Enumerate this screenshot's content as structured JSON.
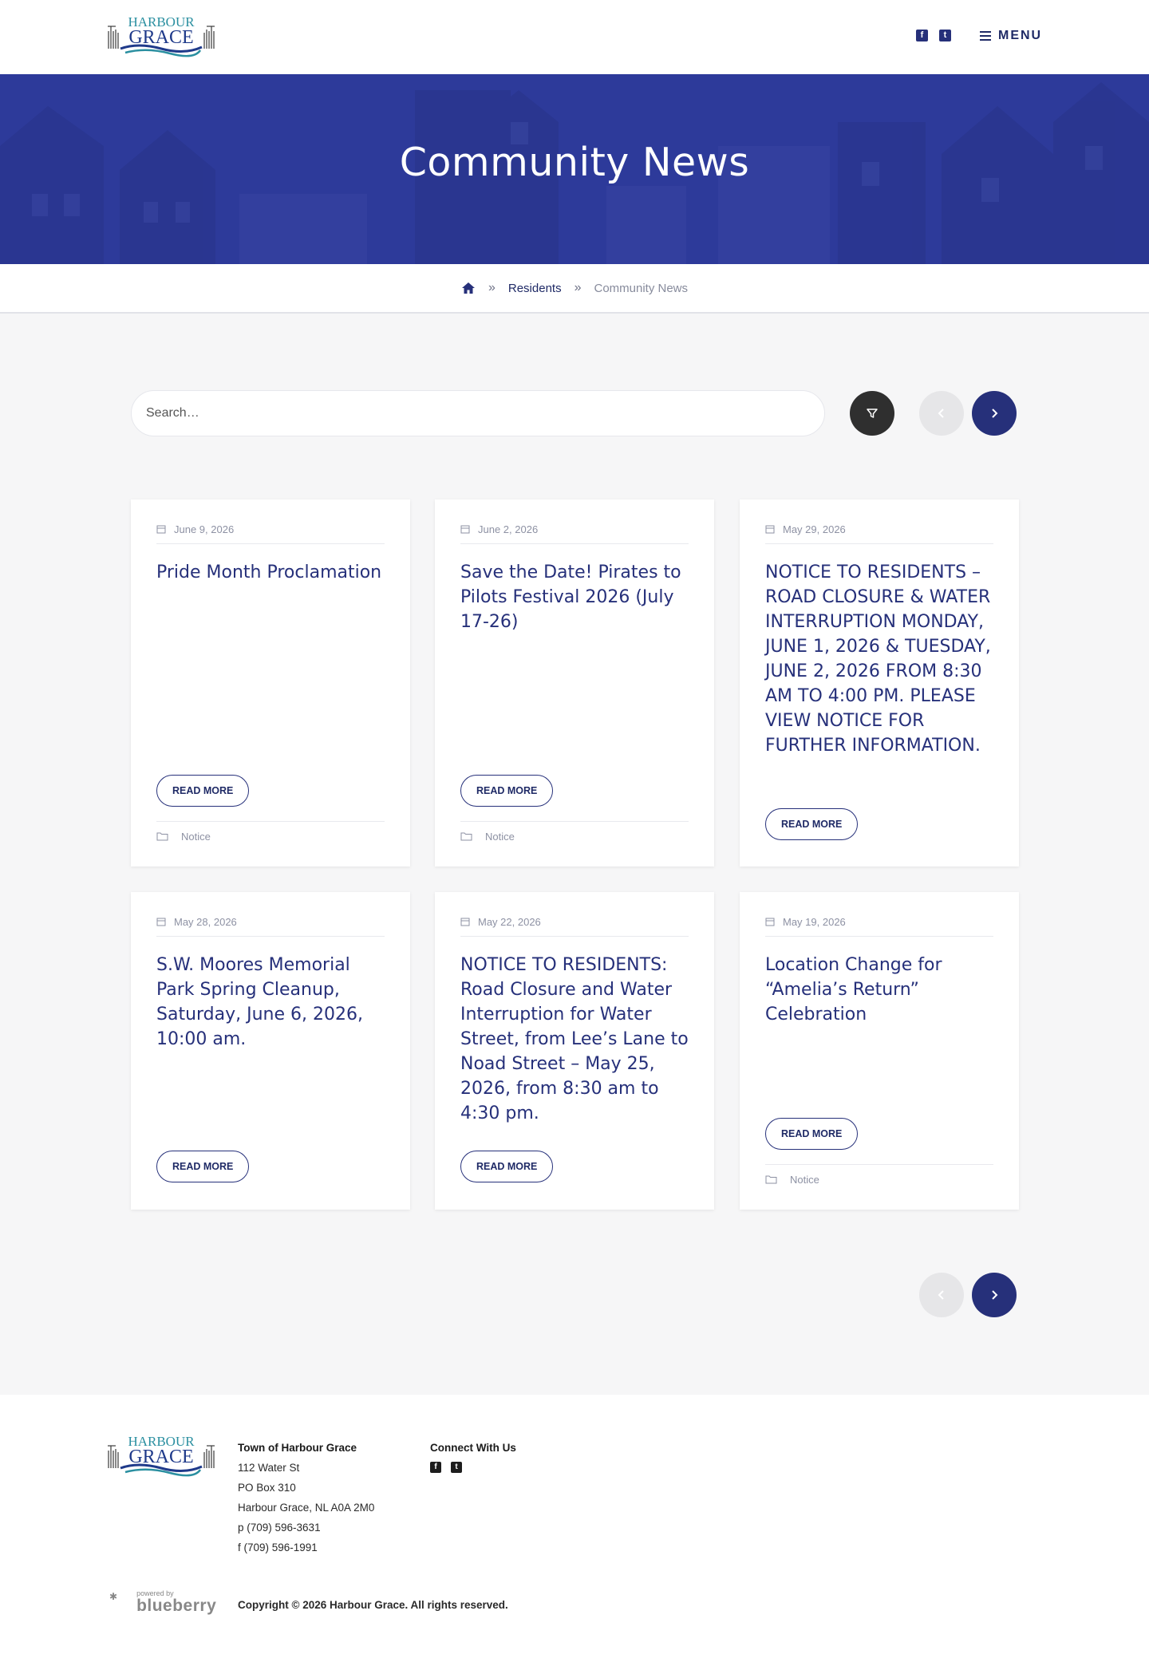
{
  "header": {
    "logo_text": [
      "HARBOUR",
      "GRACE"
    ],
    "social": [
      "facebook-icon",
      "twitter-icon"
    ],
    "menu_label": "MENU"
  },
  "hero": {
    "title": "Community News"
  },
  "breadcrumb": {
    "home_icon": "home-icon",
    "items": [
      "Residents",
      "Community News"
    ]
  },
  "search": {
    "placeholder": "Search…"
  },
  "cards": [
    {
      "date": "June 9, 2026",
      "title": "Pride Month Proclamation",
      "button": "READ MORE",
      "category": "Notice"
    },
    {
      "date": "June 2, 2026",
      "title": "Save the Date! Pirates to Pilots Festival 2026 (July 17-26)",
      "button": "READ MORE",
      "category": "Notice"
    },
    {
      "date": "May 29, 2026",
      "title": "NOTICE TO RESIDENTS – ROAD CLOSURE & WATER INTERRUPTION MONDAY, JUNE 1, 2026 & TUESDAY, JUNE 2, 2026 FROM 8:30 AM TO 4:00 PM. PLEASE VIEW NOTICE FOR FURTHER INFORMATION.",
      "button": "READ MORE",
      "category": ""
    },
    {
      "date": "May 28, 2026",
      "title": "S.W. Moores Memorial Park Spring Cleanup, Saturday, June 6, 2026, 10:00 am.",
      "button": "READ MORE",
      "category": ""
    },
    {
      "date": "May 22, 2026",
      "title": "NOTICE TO RESIDENTS: Road Closure and Water Interruption for Water Street, from Lee’s Lane to Noad Street – May 25, 2026, from 8:30 am to 4:30 pm.",
      "button": "READ MORE",
      "category": ""
    },
    {
      "date": "May 19, 2026",
      "title": "Location Change for “Amelia’s Return” Celebration",
      "button": "READ MORE",
      "category": "Notice"
    }
  ],
  "footer": {
    "org_name": "Town of Harbour Grace",
    "address": [
      "112 Water St",
      "PO Box 310",
      "Harbour Grace, NL A0A 2M0"
    ],
    "phone": "p (709) 596-3631",
    "fax": "f (709) 596-1991",
    "connect_heading": "Connect With Us",
    "powered_small": "powered by",
    "powered_brand": "blueberry",
    "copyright": "Copyright © 2026 Harbour Grace. All rights reserved."
  },
  "colors": {
    "primary": "#26307a",
    "hero_bg": "#2d3a9a",
    "main_bg": "#f6f6f7"
  }
}
